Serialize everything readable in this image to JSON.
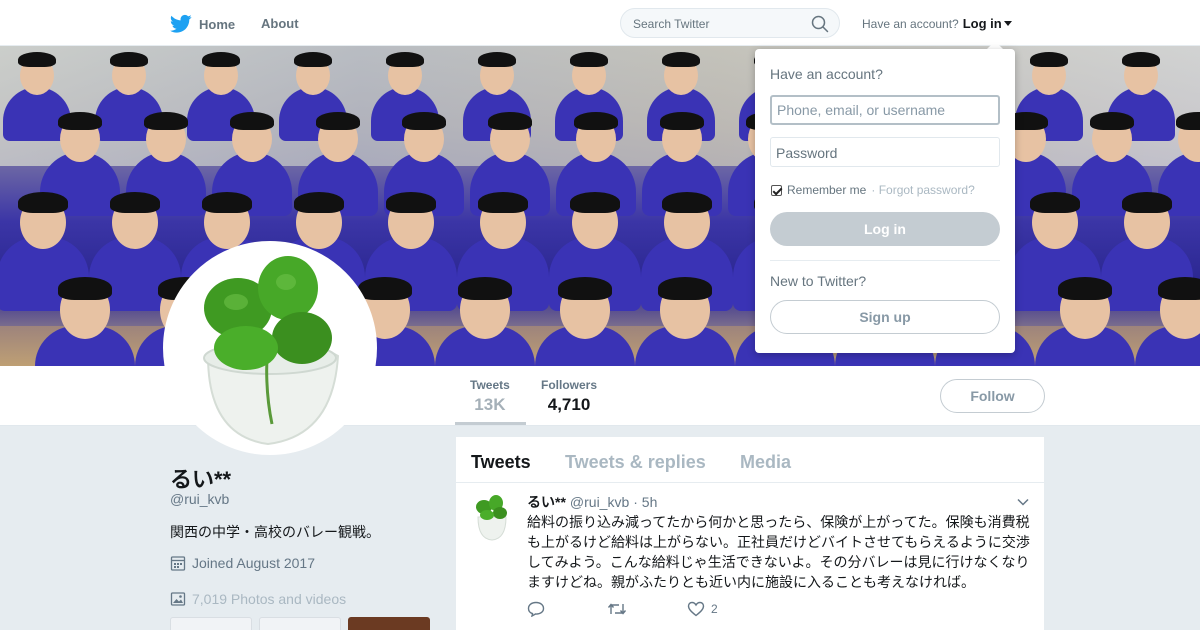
{
  "nav": {
    "home_label": "Home",
    "about_label": "About",
    "search_placeholder": "Search Twitter",
    "have_account": "Have an account?",
    "login_label": "Log in"
  },
  "profile": {
    "name": "るい**",
    "handle": "@rui_kvb",
    "bio": "関西の中学・高校のバレー観戦。",
    "joined": "Joined August 2017",
    "photos": "7,019 Photos and videos"
  },
  "stats": [
    {
      "label": "Tweets",
      "value": "13K"
    },
    {
      "label": "Followers",
      "value": "4,710"
    }
  ],
  "follow_label": "Follow",
  "tabs": [
    "Tweets",
    "Tweets & replies",
    "Media"
  ],
  "tweet": {
    "name": "るい**",
    "handle": "@rui_kvb",
    "time": "· 5h",
    "text": "給料の振り込み減ってたから何かと思ったら、保険が上がってた。保険も消費税も上がるけど給料は上がらない。正社員だけどバイトさせてもらえるように交渉してみよう。こんな給料じゃ生活できないよ。その分バレーは見に行けなくなりますけどね。親がふたりとも近い内に施設に入ることも考えなければ。",
    "likes": "2",
    "icons": [
      "reply-icon",
      "retweet-icon",
      "heart-icon"
    ]
  },
  "login_dropdown": {
    "title": "Have an account?",
    "username_placeholder": "Phone, email, or username",
    "password_placeholder": "Password",
    "remember_label": "Remember me",
    "forgot_label": "· Forgot password?",
    "login_button": "Log in",
    "new_label": "New to Twitter?",
    "signup_button": "Sign up"
  },
  "colors": {
    "brand": "#1da1f2",
    "banner_shirt": "#3a33b5",
    "button_disabled": "#c4ccd2"
  }
}
